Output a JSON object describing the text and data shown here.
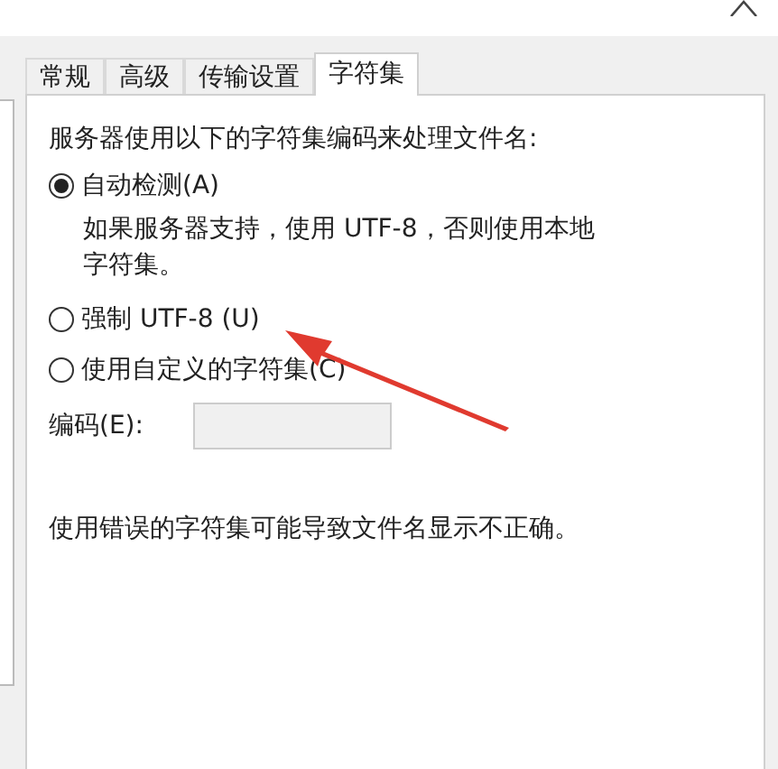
{
  "tabs": [
    {
      "label": "常规",
      "selected": false
    },
    {
      "label": "高级",
      "selected": false
    },
    {
      "label": "传输设置",
      "selected": false
    },
    {
      "label": "字符集",
      "selected": true
    }
  ],
  "heading": "服务器使用以下的字符集编码来处理文件名:",
  "options": [
    {
      "label": "自动检测(A)",
      "selected": true,
      "description": [
        "如果服务器支持，使用 UTF-8，否则使用本地",
        "字符集。"
      ]
    },
    {
      "label": "强制 UTF-8 (U)",
      "selected": false
    },
    {
      "label": "使用自定义的字符集(C)",
      "selected": false
    }
  ],
  "encoding": {
    "label": "编码(E):",
    "disabled": true
  },
  "note": "使用错误的字符集可能导致文件名显示不正确。"
}
